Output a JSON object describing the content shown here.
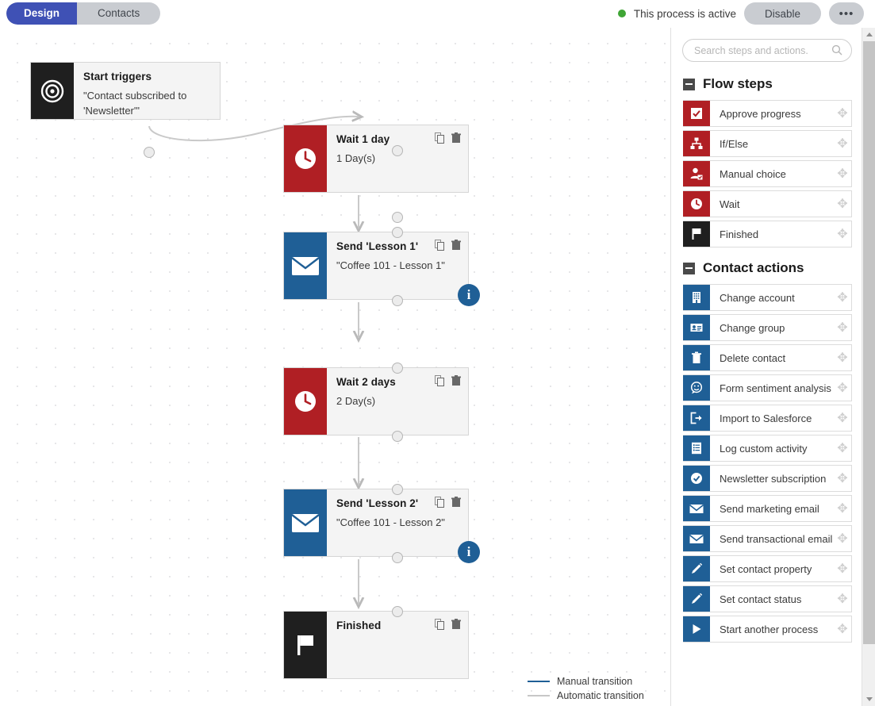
{
  "header": {
    "tabs": [
      {
        "label": "Design",
        "active": true
      },
      {
        "label": "Contacts",
        "active": false
      }
    ],
    "status_text": "This process is active",
    "status_color": "#3fa535",
    "disable_label": "Disable",
    "more_label": "•••"
  },
  "canvas": {
    "nodes": [
      {
        "id": "start-triggers",
        "icon": "target-icon",
        "icon_color": "#1f1f1f",
        "title": "Start triggers",
        "subtitle": "\"Contact subscribed to 'Newsletter'\"",
        "has_actions": false,
        "has_info": false
      },
      {
        "id": "wait-1-day",
        "icon": "clock-icon",
        "icon_color": "#b01f24",
        "title": "Wait 1 day",
        "subtitle": "1 Day(s)",
        "has_actions": true,
        "has_info": false
      },
      {
        "id": "send-lesson-1",
        "icon": "envelope-icon",
        "icon_color": "#1f5f96",
        "title": "Send 'Lesson 1'",
        "subtitle": "\"Coffee 101 - Lesson 1\"",
        "has_actions": true,
        "has_info": true
      },
      {
        "id": "wait-2-days",
        "icon": "clock-icon",
        "icon_color": "#b01f24",
        "title": "Wait 2 days",
        "subtitle": "2 Day(s)",
        "has_actions": true,
        "has_info": false
      },
      {
        "id": "send-lesson-2",
        "icon": "envelope-icon",
        "icon_color": "#1f5f96",
        "title": "Send 'Lesson 2'",
        "subtitle": "\"Coffee 101 - Lesson 2\"",
        "has_actions": true,
        "has_info": true
      },
      {
        "id": "finished",
        "icon": "flag-icon",
        "icon_color": "#1f1f1f",
        "title": "Finished",
        "subtitle": "",
        "has_actions": true,
        "has_info": false
      }
    ],
    "node_actions": {
      "copy": "copy-icon",
      "delete": "trash-icon"
    },
    "legend": [
      {
        "label": "Manual transition",
        "color": "#1f5f96"
      },
      {
        "label": "Automatic transition",
        "color": "#c7c7c7"
      }
    ]
  },
  "sidebar": {
    "search": {
      "placeholder": "Search steps and actions.",
      "value": ""
    },
    "groups": [
      {
        "title": "Flow steps",
        "items": [
          {
            "label": "Approve progress",
            "icon": "check-square-icon",
            "color": "#b01f24"
          },
          {
            "label": "If/Else",
            "icon": "sitemap-icon",
            "color": "#b01f24"
          },
          {
            "label": "Manual choice",
            "icon": "user-check-icon",
            "color": "#b01f24"
          },
          {
            "label": "Wait",
            "icon": "clock-icon",
            "color": "#b01f24"
          },
          {
            "label": "Finished",
            "icon": "flag-icon",
            "color": "#1f1f1f"
          }
        ]
      },
      {
        "title": "Contact actions",
        "items": [
          {
            "label": "Change account",
            "icon": "building-icon",
            "color": "#1f5f96"
          },
          {
            "label": "Change group",
            "icon": "id-card-icon",
            "color": "#1f5f96"
          },
          {
            "label": "Delete contact",
            "icon": "trash-icon",
            "color": "#1f5f96"
          },
          {
            "label": "Form sentiment analysis",
            "icon": "smiley-icon",
            "color": "#1f5f96"
          },
          {
            "label": "Import to Salesforce",
            "icon": "export-icon",
            "color": "#1f5f96"
          },
          {
            "label": "Log custom activity",
            "icon": "list-doc-icon",
            "color": "#1f5f96"
          },
          {
            "label": "Newsletter subscription",
            "icon": "check-circle-icon",
            "color": "#1f5f96"
          },
          {
            "label": "Send marketing email",
            "icon": "envelope-icon",
            "color": "#1f5f96"
          },
          {
            "label": "Send transactional email",
            "icon": "envelope-icon",
            "color": "#1f5f96"
          },
          {
            "label": "Set contact property",
            "icon": "pencil-icon",
            "color": "#1f5f96"
          },
          {
            "label": "Set contact status",
            "icon": "pencil-icon",
            "color": "#1f5f96"
          },
          {
            "label": "Start another process",
            "icon": "play-icon",
            "color": "#1f5f96"
          }
        ]
      }
    ]
  }
}
